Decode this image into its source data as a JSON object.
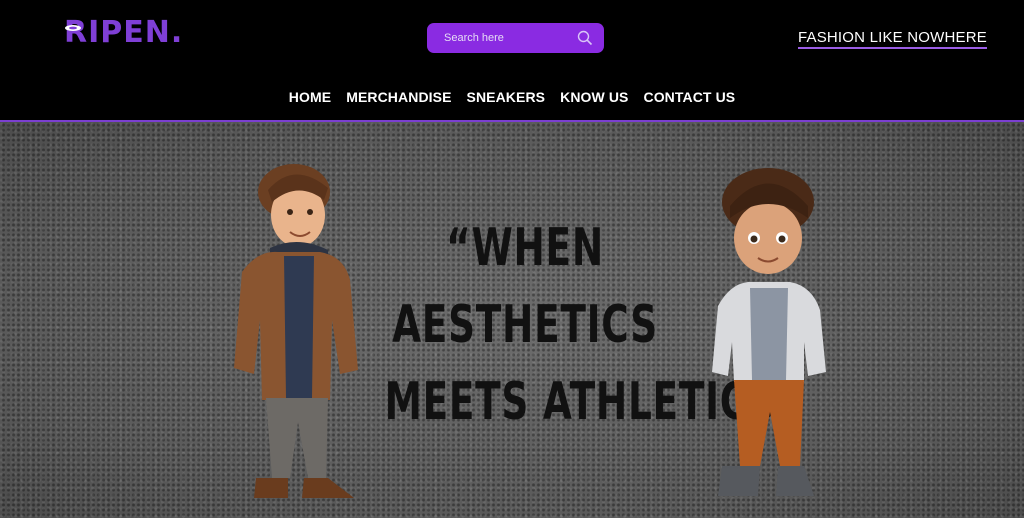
{
  "header": {
    "logo_text": "RIPEN.",
    "search": {
      "placeholder": "Search here"
    },
    "tagline": "FASHION LIKE NOWHERE",
    "nav": [
      "HOME",
      "MERCHANDISE",
      "SNEAKERS",
      "KNOW US",
      "CONTACT US"
    ]
  },
  "hero": {
    "quote_lines": [
      "“WHEN",
      "AESTHETICS",
      "MEETS ATHLETICS”"
    ]
  },
  "colors": {
    "accent": "#8a2be2",
    "logo": "#7f3fd6",
    "header_bg": "#000000"
  },
  "icons": [
    "search-icon",
    "logo-mark-icon"
  ]
}
